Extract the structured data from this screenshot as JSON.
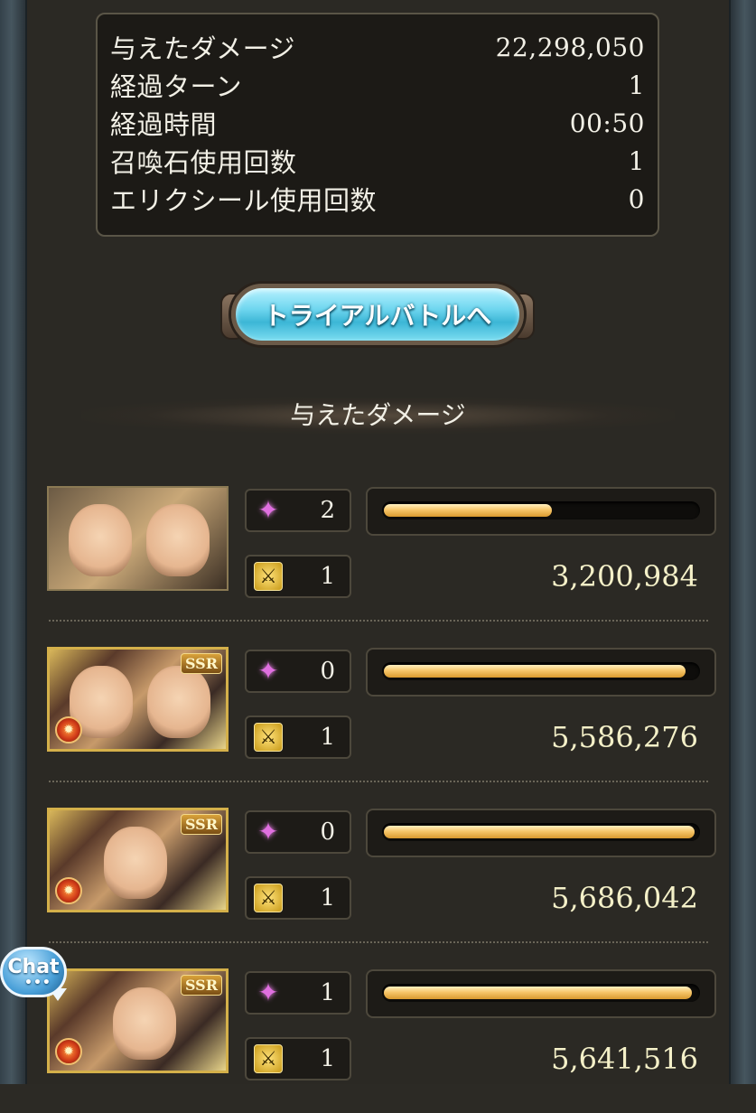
{
  "summary": {
    "rows": [
      {
        "label": "与えたダメージ",
        "value": "22,298,050"
      },
      {
        "label": "経過ターン",
        "value": "1"
      },
      {
        "label": "経過時間",
        "value": "00:50"
      },
      {
        "label": "召喚石使用回数",
        "value": "1"
      },
      {
        "label": "エリクシール使用回数",
        "value": "0"
      }
    ]
  },
  "trial_button": {
    "label": "トライアルバトルへ"
  },
  "section_title": "与えたダメージ",
  "characters": [
    {
      "rarity": "",
      "ssr_label": "",
      "charge_label": "2",
      "attack_label": "1",
      "damage": "3,200,984",
      "bar_fill": 0.54,
      "element": "",
      "icons": {
        "charge": "purple-spark-icon",
        "attack": "crossed-swords-icon"
      }
    },
    {
      "rarity": "SSR",
      "ssr_label": "SSR",
      "charge_label": "0",
      "attack_label": "1",
      "damage": "5,586,276",
      "bar_fill": 0.96,
      "element": "fire",
      "icons": {
        "charge": "purple-spark-icon",
        "attack": "crossed-swords-icon"
      }
    },
    {
      "rarity": "SSR",
      "ssr_label": "SSR",
      "charge_label": "0",
      "attack_label": "1",
      "damage": "5,686,042",
      "bar_fill": 0.99,
      "element": "fire",
      "icons": {
        "charge": "purple-spark-icon",
        "attack": "crossed-swords-icon"
      }
    },
    {
      "rarity": "SSR",
      "ssr_label": "SSR",
      "charge_label": "1",
      "attack_label": "1",
      "damage": "5,641,516",
      "bar_fill": 0.98,
      "element": "fire",
      "icons": {
        "charge": "purple-spark-icon",
        "attack": "crossed-swords-icon"
      }
    }
  ],
  "chat": {
    "label": "Chat"
  },
  "colors": {
    "bar_fill": "#f7c66a",
    "panel_bg": "#1d1b17",
    "accent_cyan": "#6fd6ef",
    "fire": "#d03a18"
  }
}
